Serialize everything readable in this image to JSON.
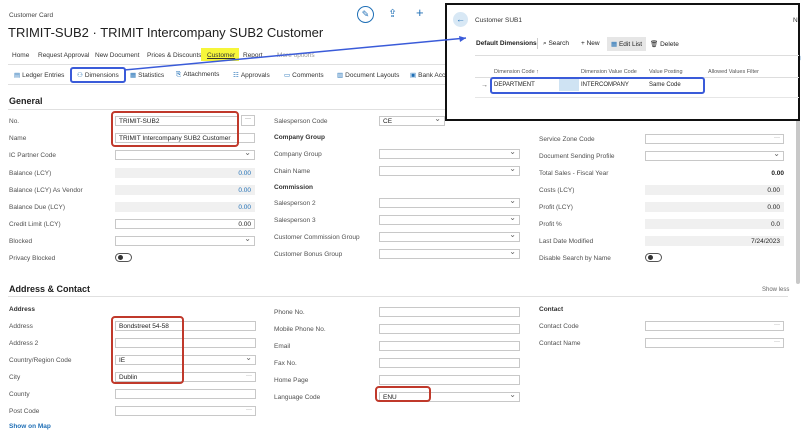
{
  "page": {
    "breadcrumb": "Customer Card",
    "title": "TRIMIT-SUB2 · TRIMIT Intercompany SUB2 Customer"
  },
  "menu": [
    "Home",
    "Request Approval",
    "New Document",
    "Prices & Discounts",
    "Customer",
    "Report",
    "More options"
  ],
  "actions": [
    "Ledger Entries",
    "Dimensions",
    "Statistics",
    "Attachments",
    "Approvals",
    "Comments",
    "Document Layouts",
    "Bank Acc"
  ],
  "general": {
    "heading": "General",
    "col1": [
      {
        "label": "No.",
        "value": "TRIMIT-SUB2"
      },
      {
        "label": "Name",
        "value": "TRIMIT Intercompany SUB2 Customer"
      },
      {
        "label": "IC Partner Code",
        "value": ""
      },
      {
        "label": "Balance (LCY)",
        "value": "0.00"
      },
      {
        "label": "Balance (LCY) As Vendor",
        "value": "0.00"
      },
      {
        "label": "Balance Due (LCY)",
        "value": "0.00"
      },
      {
        "label": "Credit Limit (LCY)",
        "value": "0.00"
      },
      {
        "label": "Blocked",
        "value": ""
      },
      {
        "label": "Privacy Blocked",
        "value": ""
      }
    ],
    "col2": {
      "salesperson_label": "Salesperson Code",
      "salesperson_value": "CE",
      "company_group_heading": "Company Group",
      "company_group_label": "Company Group",
      "chain_name_label": "Chain Name",
      "commission_heading": "Commission",
      "salesperson2_label": "Salesperson 2",
      "salesperson3_label": "Salesperson 3",
      "comm_group_label": "Customer Commission Group",
      "bonus_group_label": "Customer Bonus Group"
    },
    "col3": [
      {
        "label": "Service Zone Code",
        "value": ""
      },
      {
        "label": "Document Sending Profile",
        "value": ""
      },
      {
        "label": "Total Sales - Fiscal Year",
        "value": "0.00"
      },
      {
        "label": "Costs (LCY)",
        "value": "0.00"
      },
      {
        "label": "Profit (LCY)",
        "value": "0.00"
      },
      {
        "label": "Profit %",
        "value": "0.0"
      },
      {
        "label": "Last Date Modified",
        "value": "7/24/2023"
      },
      {
        "label": "Disable Search by Name",
        "value": ""
      }
    ]
  },
  "address": {
    "heading": "Address & Contact",
    "show_less": "Show less",
    "address_heading": "Address",
    "fields": [
      {
        "label": "Address",
        "value": "Bondstreet 54-58"
      },
      {
        "label": "Address 2",
        "value": ""
      },
      {
        "label": "Country/Region Code",
        "value": "IE"
      },
      {
        "label": "City",
        "value": "Dublin"
      },
      {
        "label": "County",
        "value": ""
      },
      {
        "label": "Post Code",
        "value": ""
      }
    ],
    "show_on_map": "Show on Map",
    "col2": [
      {
        "label": "Phone No.",
        "value": ""
      },
      {
        "label": "Mobile Phone No.",
        "value": ""
      },
      {
        "label": "Email",
        "value": ""
      },
      {
        "label": "Fax No.",
        "value": ""
      },
      {
        "label": "Home Page",
        "value": ""
      },
      {
        "label": "Language Code",
        "value": "ENU"
      }
    ],
    "contact_heading": "Contact",
    "contact_code_label": "Contact Code",
    "contact_name_label": "Contact Name"
  },
  "popup": {
    "title": "Customer SUB1",
    "edge_letter": "N",
    "tab": "Default Dimensions",
    "search": "Search",
    "new": "New",
    "edit_list": "Edit List",
    "delete": "Delete",
    "columns": [
      "Dimension Code ↑",
      "Dimension Value Code",
      "Value Posting",
      "Allowed Values Filter"
    ],
    "row": [
      "DEPARTMENT",
      "INTERCOMPANY",
      "Same Code",
      ""
    ]
  }
}
